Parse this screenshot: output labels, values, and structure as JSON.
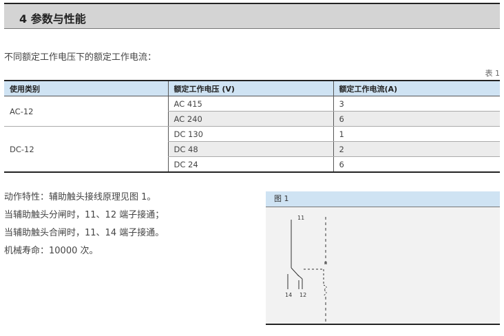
{
  "section": {
    "title": "4 参数与性能"
  },
  "intro": "不同额定工作电压下的额定工作电流：",
  "table": {
    "caption": "表 1",
    "headers": [
      "使用类别",
      "额定工作电压 (V)",
      "额定工作电流(A)"
    ],
    "groups": [
      {
        "category": "AC-12",
        "rows": [
          {
            "voltage": "AC 415",
            "current": "3"
          },
          {
            "voltage": "AC 240",
            "current": "6"
          }
        ]
      },
      {
        "category": "DC-12",
        "rows": [
          {
            "voltage": "DC 130",
            "current": "1"
          },
          {
            "voltage": "DC 48",
            "current": "2"
          },
          {
            "voltage": "DC 24",
            "current": "6"
          }
        ]
      }
    ]
  },
  "features": [
    "动作特性：辅助触头接线原理见图 1。",
    "当辅助触头分闸时，11、12 端子接通；",
    "当辅助触头合闸时，11、14 端子接通。",
    "机械寿命：10000 次。"
  ],
  "figure": {
    "title": "图 1",
    "terminal_top": "11",
    "terminal_left": "14",
    "terminal_right": "12"
  },
  "colors": {
    "header_fill": "#d4d4d4",
    "table_header_blue": "#cfe3f3",
    "row_shade": "#ececec"
  }
}
